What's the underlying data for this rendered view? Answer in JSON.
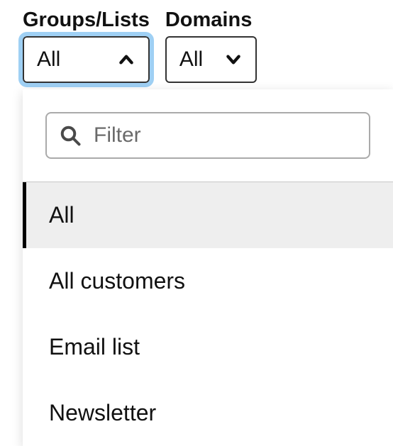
{
  "filters": {
    "groups": {
      "label": "Groups/Lists",
      "value": "All",
      "open": true
    },
    "domains": {
      "label": "Domains",
      "value": "All",
      "open": false
    }
  },
  "dropdown": {
    "filter_placeholder": "Filter",
    "options": [
      {
        "label": "All",
        "selected": true
      },
      {
        "label": "All customers",
        "selected": false
      },
      {
        "label": "Email list",
        "selected": false
      },
      {
        "label": "Newsletter",
        "selected": false
      }
    ]
  },
  "background_hint": "ce"
}
